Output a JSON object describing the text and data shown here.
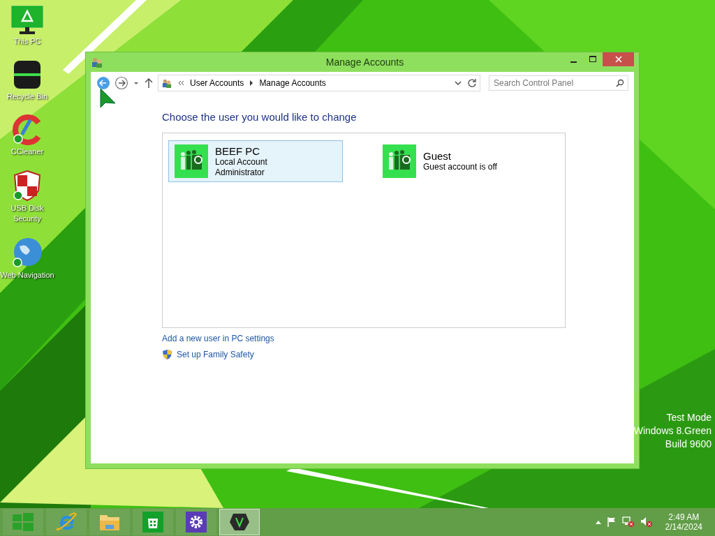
{
  "desktop_icons": [
    {
      "label": "This PC",
      "kind": "monitor"
    },
    {
      "label": "Recycle Bin",
      "kind": "bin"
    },
    {
      "label": "CCleaner",
      "kind": "cleaner"
    },
    {
      "label": "USB Disk Security",
      "kind": "shield"
    },
    {
      "label": "Web Navigation",
      "kind": "globe"
    }
  ],
  "window": {
    "title": "Manage Accounts",
    "address": {
      "crumbs": [
        "User Accounts",
        "Manage Accounts"
      ]
    },
    "search": {
      "placeholder": "Search Control Panel"
    },
    "heading": "Choose the user you would like to change",
    "accounts": [
      {
        "name": "BEEF PC",
        "details": [
          "Local Account",
          "Administrator"
        ],
        "selected": true
      },
      {
        "name": "Guest",
        "details": [
          "Guest account is off"
        ],
        "selected": false
      }
    ],
    "links": [
      {
        "label": "Add a new user in PC settings",
        "kind": "plain"
      },
      {
        "label": "Set up Family Safety",
        "kind": "shield"
      }
    ]
  },
  "watermark": [
    "Test Mode",
    "Windows 8.Green",
    "Build 9600"
  ],
  "taskbar": {
    "apps": [
      {
        "kind": "ie",
        "selected": false
      },
      {
        "kind": "explorer",
        "selected": false
      },
      {
        "kind": "store",
        "selected": false
      },
      {
        "kind": "settings",
        "selected": false
      },
      {
        "kind": "app",
        "selected": true
      }
    ],
    "time": "2:49 AM",
    "date": "2/14/2024"
  }
}
